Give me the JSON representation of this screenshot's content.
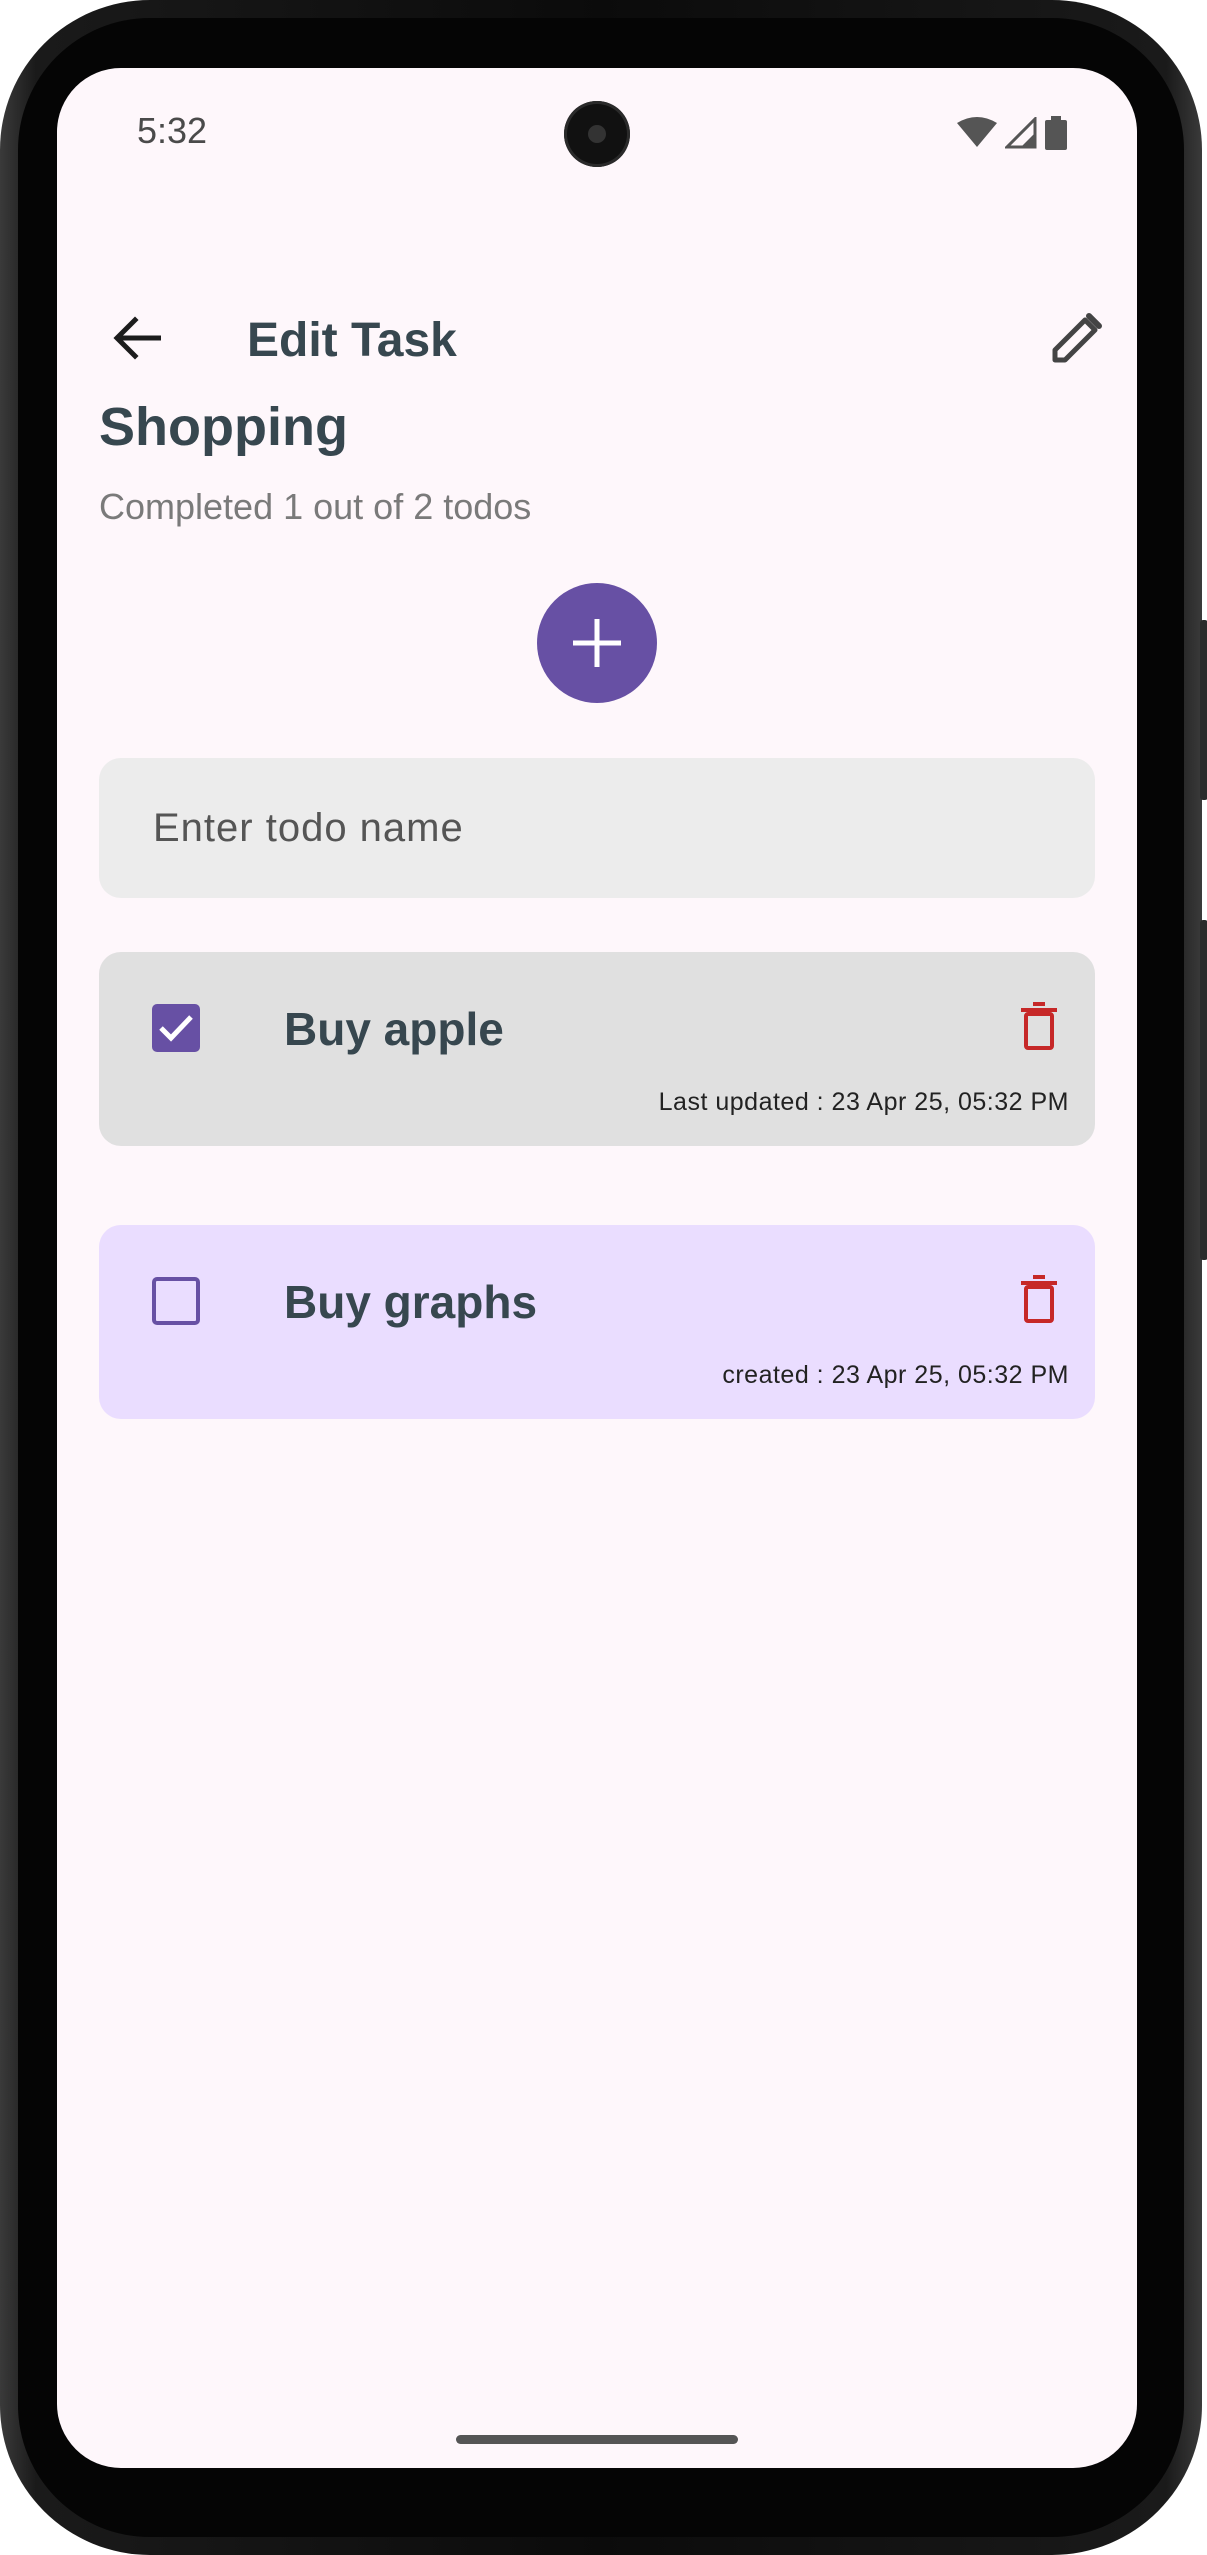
{
  "status_bar": {
    "time": "5:32"
  },
  "app_bar": {
    "title": "Edit Task",
    "back_icon": "arrow-back-icon",
    "edit_icon": "pencil-icon"
  },
  "task": {
    "title": "Shopping",
    "summary": "Completed 1 out of 2 todos"
  },
  "add_button": {
    "icon": "plus-icon"
  },
  "todo_input": {
    "value": "",
    "placeholder": "Enter todo name"
  },
  "todos": [
    {
      "name": "Buy apple",
      "checked": true,
      "meta": "Last updated : 23 Apr 25, 05:32 PM"
    },
    {
      "name": "Buy graphs",
      "checked": false,
      "meta": "created : 23 Apr 25, 05:32 PM"
    }
  ],
  "colors": {
    "primary": "#6750a4",
    "background": "#fef7fb",
    "title_text": "#37474f",
    "done_card": "#e0e0e0",
    "open_card": "#eaddff",
    "delete": "#c62828"
  }
}
